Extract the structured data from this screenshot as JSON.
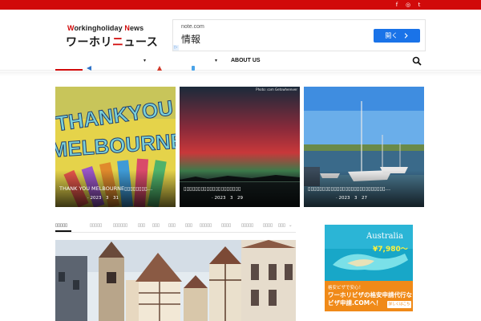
{
  "social": {
    "facebook_icon": "f",
    "instagram_icon": "◎",
    "twitter_icon": "t"
  },
  "logo": {
    "en_w": "W",
    "en_1": "orkingholiday ",
    "en_n": "N",
    "en_2": "ews",
    "jp_1": "ワーホリ",
    "jp_red": "ニ",
    "jp_2": "ュース"
  },
  "top_ad": {
    "source": "note.com",
    "title": "情報",
    "button": "開く",
    "button_icon": "chevron-right-icon"
  },
  "nav": {
    "about": "ABOUT US",
    "caret": "▾"
  },
  "cards": [
    {
      "title": "THANK YOU MELBOURNE▯▯▯▯▯▯▯▯…",
      "date": "· 2023　3　31"
    },
    {
      "title": "▯▯▯▯▯▯▯▯▯▯▯▯▯▯▯▯▯▯▯▯",
      "date": "· 2023　3　29",
      "credit": "Photo: com Getswherever"
    },
    {
      "title": "▯▯▯▯▯▯▯▯▯▯▯▯▯▯▯▯▯▯▯▯▯▯▯▯▯▯▯…",
      "date": "· 2023　3　27"
    }
  ],
  "tabs": [
    "▯▯▯▯▯",
    "▯▯▯▯▯",
    "▯▯▯▯▯▯",
    "▯▯▯",
    "▯▯▯",
    "▯▯▯",
    "▯▯▯",
    "▯▯▯▯▯",
    "▯▯▯▯",
    "▯▯▯▯▯",
    "▯▯▯▯",
    "▯▯▯"
  ],
  "tab_caret": "⌄",
  "side_ad": {
    "label": "Australia",
    "price": "¥7,980〜",
    "line1": "格安ビザで安心！",
    "line2": "ワーホリビザの格安申請代行なら",
    "line3": "ビザ申請.COMへ！",
    "more": "詳しくはこちら"
  }
}
